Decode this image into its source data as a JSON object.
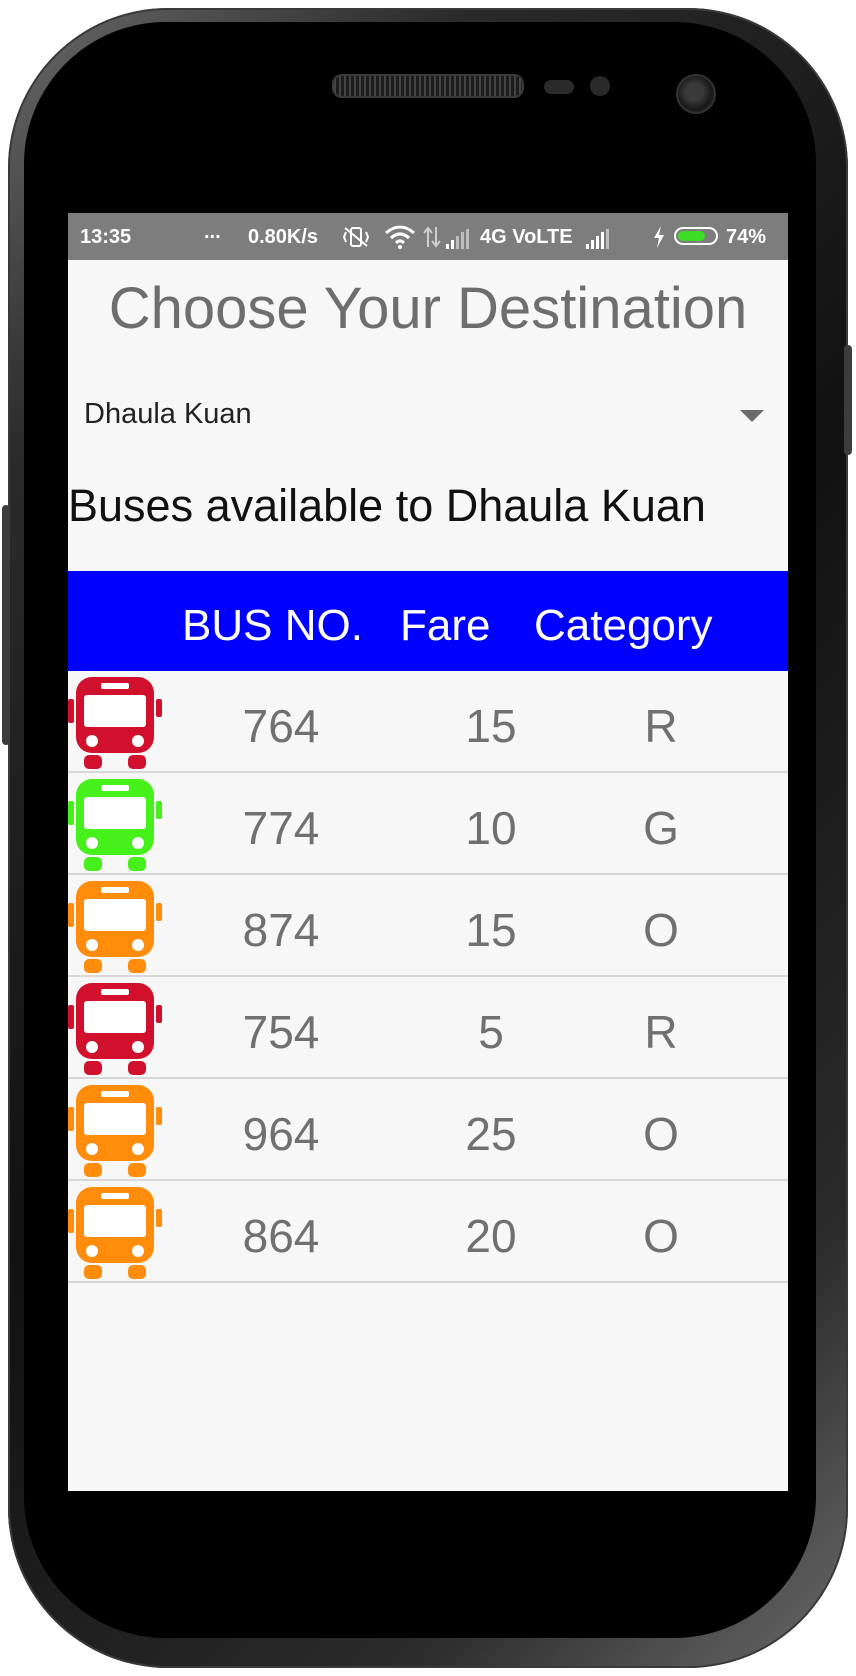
{
  "status_bar": {
    "time": "13:35",
    "dots": "...",
    "speed": "0.80K/s",
    "network": "4G VoLTE",
    "battery": "74%",
    "battery_level": 0.74
  },
  "page": {
    "title": "Choose Your Destination",
    "destination": "Dhaula Kuan",
    "subtitle": "Buses available to Dhaula Kuan"
  },
  "table": {
    "headers": {
      "bus_no": "BUS NO.",
      "fare": "Fare",
      "category": "Category"
    },
    "rows": [
      {
        "bus_no": "764",
        "fare": "15",
        "category": "R",
        "icon_color": "#d0102c"
      },
      {
        "bus_no": "774",
        "fare": "10",
        "category": "G",
        "icon_color": "#46f01a"
      },
      {
        "bus_no": "874",
        "fare": "15",
        "category": "O",
        "icon_color": "#ff8c0a"
      },
      {
        "bus_no": "754",
        "fare": "5",
        "category": "R",
        "icon_color": "#d0102c"
      },
      {
        "bus_no": "964",
        "fare": "25",
        "category": "O",
        "icon_color": "#ff8c0a"
      },
      {
        "bus_no": "864",
        "fare": "20",
        "category": "O",
        "icon_color": "#ff8c0a"
      }
    ]
  },
  "colors": {
    "header_bg": "#0000ff",
    "status_bg": "#7d7d7d",
    "screen_bg": "#f7f7f7"
  },
  "icons": {
    "row_icon": "bus-icon",
    "dropdown": "caret-down-icon"
  }
}
